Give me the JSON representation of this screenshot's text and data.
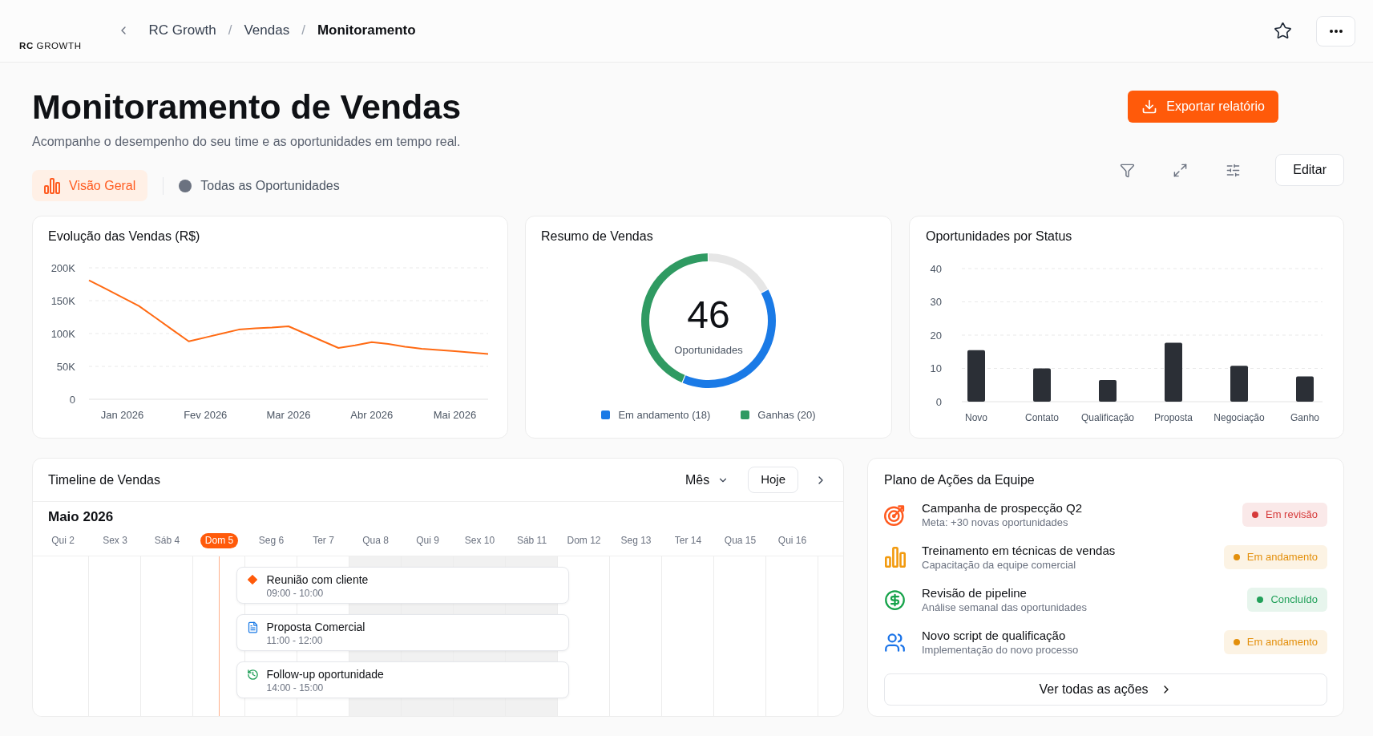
{
  "header": {
    "logo": "**RC** GROWTH",
    "breadcrumb": [
      {
        "label": "RC Growth",
        "current": false
      },
      {
        "separator": "/",
        "label": "Vendas",
        "current": false
      },
      {
        "separator": "/",
        "label": "Monitoramento",
        "current": true
      }
    ]
  },
  "page": {
    "title": "Monitoramento de Vendas",
    "subtitle": "Acompanhe o desempenho do seu time e as oportunidades em tempo real.",
    "export_button": "Exportar relatório"
  },
  "tabs": [
    {
      "label": "Visão Geral",
      "selected": true,
      "kind": "chart"
    },
    {
      "label": "Todas as Oportunidades",
      "selected": false,
      "kind": "dot"
    }
  ],
  "toolbar": {
    "edit_button": "Editar"
  },
  "sales_chart": {
    "title": "Evolução das Vendas (R$)",
    "chart_data": {
      "type": "line",
      "grid": true,
      "categories": [
        null,
        null,
        "Jan 2026",
        null,
        null,
        null,
        null,
        "Fev 2026",
        null,
        null,
        null,
        null,
        "Mar 2026",
        null,
        null,
        null,
        null,
        "Abr 2026",
        null,
        null,
        null,
        null,
        "Mai 2026",
        null,
        null
      ],
      "series": [
        {
          "color": "#ff6a13",
          "values": [
            181000,
            168000,
            155000,
            142000,
            124000,
            106000,
            88000,
            94000,
            100000,
            106000,
            108000,
            109000,
            111000,
            100000,
            89000,
            78000,
            82000,
            87000,
            84000,
            80000,
            77000,
            75000,
            73000,
            71000,
            69000
          ]
        }
      ],
      "ylim": [
        0,
        200000
      ],
      "yticks": [
        {
          "value": 0,
          "label": "0"
        },
        {
          "value": 50000,
          "label": "50K"
        },
        {
          "value": 100000,
          "label": "100K"
        },
        {
          "value": 150000,
          "label": "150K"
        },
        {
          "value": 200000,
          "label": "200K"
        }
      ]
    }
  },
  "summary": {
    "title": "Resumo de Vendas",
    "total": "46",
    "total_label": "Oportunidades",
    "legend": [
      {
        "color": "#1a7ae6"
      },
      {
        "color": "#2f9a62"
      }
    ],
    "chart_data": {
      "type": "donut",
      "categories": [
        "Em andamento (18)",
        "Ganhas (20)",
        null
      ],
      "values": [
        18,
        20,
        8
      ]
    }
  },
  "status_chart": {
    "title": "Oportunidades por Status",
    "chart_data": {
      "type": "bar",
      "grid": true,
      "categories": [
        "Novo",
        "Contato",
        "Qualificação",
        "Proposta",
        "Negociação",
        "Ganho"
      ],
      "values": [
        15.5,
        10,
        6.5,
        17.7,
        10.8,
        7.6
      ],
      "ylim": [
        0,
        40
      ],
      "yticks": [
        0,
        10,
        20,
        30,
        40
      ]
    }
  },
  "timeline": {
    "title": "Timeline de Vendas",
    "view_select": "Mês",
    "today_button": "Hoje",
    "month": "Maio 2026",
    "days": [
      {
        "label": "Qui 2",
        "selected": false,
        "shaded": false
      },
      {
        "label": "Sex 3",
        "selected": false,
        "shaded": false
      },
      {
        "label": "Sáb 4",
        "selected": false,
        "shaded": false
      },
      {
        "label": "Dom 5",
        "selected": true,
        "shaded": false
      },
      {
        "label": "Seg 6",
        "selected": false,
        "shaded": false
      },
      {
        "label": "Ter 7",
        "selected": false,
        "shaded": false
      },
      {
        "label": "Qua 8",
        "selected": false,
        "shaded": true
      },
      {
        "label": "Qui 9",
        "selected": false,
        "shaded": true
      },
      {
        "label": "Sex 10",
        "selected": false,
        "shaded": true
      },
      {
        "label": "Sáb 11",
        "selected": false,
        "shaded": true
      },
      {
        "label": "Dom 12",
        "selected": false,
        "shaded": false
      },
      {
        "label": "Seg 13",
        "selected": false,
        "shaded": false
      },
      {
        "label": "Ter 14",
        "selected": false,
        "shaded": false
      },
      {
        "label": "Qua 15",
        "selected": false,
        "shaded": false
      },
      {
        "label": "Qui 16",
        "selected": false,
        "shaded": false
      }
    ],
    "events": [
      {
        "kind": "meeting",
        "title": "Reunião com cliente",
        "time": "09:00 - 10:00"
      },
      {
        "kind": "document",
        "title": "Proposta Comercial",
        "time": "11:00 - 12:00"
      },
      {
        "kind": "followup",
        "title": "Follow-up oportunidade",
        "time": "14:00 - 15:00"
      }
    ]
  },
  "action_plan": {
    "title": "Plano de Ações da Equipe",
    "items": [
      {
        "kind": "target",
        "title": "Campanha de prospecção Q2",
        "subtitle": "Meta: +30 novas oportunidades",
        "status": "Em revisão",
        "color": "#d63b3b"
      },
      {
        "kind": "chart",
        "title": "Treinamento em técnicas de vendas",
        "subtitle": "Capacitação da equipe comercial",
        "status": "Em andamento",
        "color": "#e38f0b"
      },
      {
        "kind": "money",
        "title": "Revisão de pipeline",
        "subtitle": "Análise semanal das oportunidades",
        "status": "Concluído",
        "color": "#22a05a"
      },
      {
        "kind": "team",
        "title": "Novo script de qualificação",
        "subtitle": "Implementação do novo processo",
        "status": "Em andamento",
        "color": "#e38f0b"
      }
    ],
    "view_all_button": "Ver todas as ações"
  }
}
